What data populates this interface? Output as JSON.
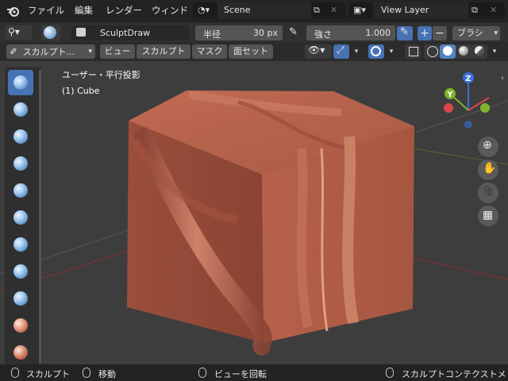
{
  "topbar": {
    "menus": [
      "ファイル",
      "編集",
      "レンダー",
      "ウィンド"
    ],
    "scene": "Scene",
    "view_layer": "View Layer"
  },
  "toolhdr": {
    "brush_name": "SculptDraw",
    "radius_label": "半径",
    "radius_value": "30 px",
    "strength_label": "強さ",
    "strength_value": "1.000",
    "plus": "+",
    "minus": "−",
    "brush_menu": "ブラシ"
  },
  "modehdr": {
    "mode": "スカルプト...",
    "menus": [
      "ビュー",
      "スカルプト",
      "マスク",
      "面セット"
    ]
  },
  "viewport": {
    "view_name": "ユーザー・平行投影",
    "object_name": "(1) Cube",
    "gizmo": {
      "z": "Z",
      "y": "Y"
    },
    "colors": {
      "x_axis": "#d8464b",
      "y_axis": "#80b32c",
      "z_axis": "#3b6fd8",
      "object": "#b05a42"
    }
  },
  "statusbar": {
    "items": [
      "スカルプト",
      "移動",
      "ビューを回転",
      "スカルプトコンテクストメ"
    ]
  }
}
